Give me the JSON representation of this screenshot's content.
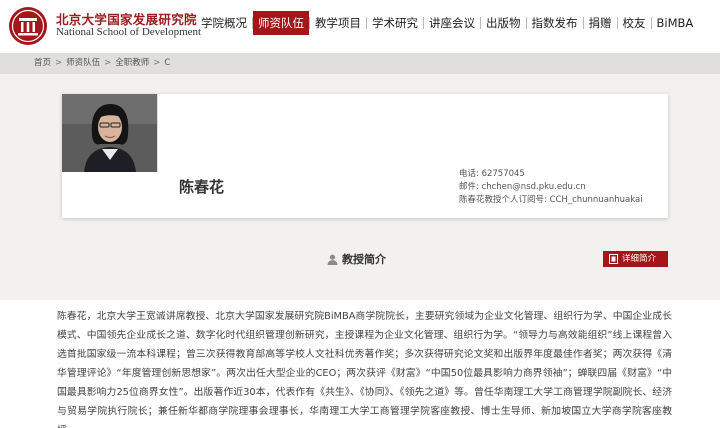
{
  "header": {
    "logo_cn": "北京大学国家发展研究院",
    "logo_en": "National School of Development"
  },
  "nav": {
    "items": [
      {
        "label": "学院概况",
        "active": false
      },
      {
        "label": "师资队伍",
        "active": true
      },
      {
        "label": "教学项目",
        "active": false
      },
      {
        "label": "学术研究",
        "active": false
      },
      {
        "label": "讲座会议",
        "active": false
      },
      {
        "label": "出版物",
        "active": false
      },
      {
        "label": "指数发布",
        "active": false
      },
      {
        "label": "捐赠",
        "active": false
      },
      {
        "label": "校友",
        "active": false
      },
      {
        "label": "BiMBA",
        "active": false
      }
    ]
  },
  "breadcrumb": {
    "items": [
      "首页",
      "师资队伍",
      "全职教师",
      "C"
    ],
    "separator": ">"
  },
  "profile": {
    "name": "陈春花",
    "phone": "电话: 62757045",
    "email": "邮件: chchen@nsd.pku.edu.cn",
    "wechat": "陈春花教授个人订阅号: CCH_chunnuanhuakai"
  },
  "section": {
    "title": "教授简介",
    "detail_button": "详细简介"
  },
  "bio": {
    "text": "陈春花，北京大学王宽诚讲席教授、北京大学国家发展研究院BiMBA商学院院长，主要研究领域为企业文化管理、组织行为学、中国企业成长模式、中国领先企业成长之道、数字化时代组织管理创新研究，主授课程为企业文化管理、组织行为学。“领导力与高效能组织”线上课程曾入选首批国家级一流本科课程；曾三次获得教育部高等学校人文社科优秀著作奖；多次获得研究论文奖和出版界年度最佳作者奖；两次获得《清华管理评论》“年度管理创新思想家”。两次出任大型企业的CEO；两次获评《财富》“中国50位最具影响力商界领袖”；蝉联四届《财富》“中国最具影响力25位商界女性”。出版著作近30本，代表作有《共生》、《协同》、《领先之道》等。曾任华南理工大学工商管理学院副院长、经济与贸易学院执行院长；兼任新华都商学院理事会理事长，华南理工大学工商管理学院客座教授、博士生导师、新加坡国立大学商学院客座教授。"
  },
  "colors": {
    "brand_red": "#a5161b",
    "crumb_bar": "#e1dfdb",
    "panel_bg": "#f2f1ef"
  }
}
